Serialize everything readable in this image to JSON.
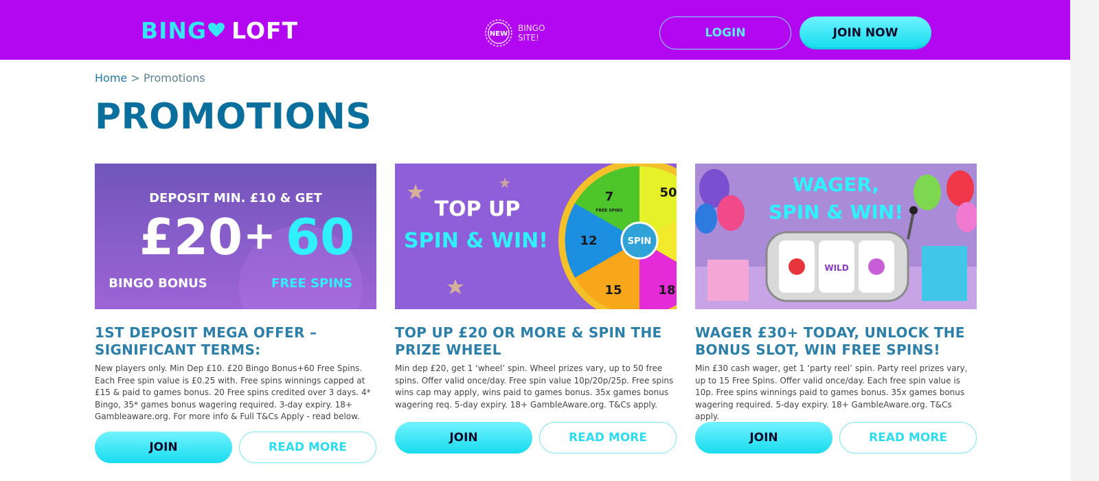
{
  "header": {
    "logo_part1": "BING",
    "logo_part2": "LOFT",
    "badge_seal": "NEW",
    "badge_line1": "BINGO",
    "badge_line2": "SITE!",
    "login_label": "LOGIN",
    "join_now_label": "JOIN NOW"
  },
  "breadcrumb": {
    "home": "Home",
    "separator": ">",
    "current": "Promotions"
  },
  "page_title": "PROMOTIONS",
  "promos": [
    {
      "banner": {
        "line1": "DEPOSIT MIN. £10 & GET",
        "amount1": "£20",
        "plus": "+",
        "amount2": "60",
        "label1": "BINGO BONUS",
        "label2": "FREE SPINS"
      },
      "title": "1ST DEPOSIT MEGA OFFER – SIGNIFICANT TERMS:",
      "terms": "New players only. Min Dep £10. £20 Bingo Bonus+60 Free Spins. Each Free spin value is £0.25 with. Free spins winnings capped at £15 & paid to games bonus. 20 Free spins credited over 3 days. 4* Bingo, 35* games bonus wagering required. 3-day expiry. 18+ Gambleaware.org. For more info & Full T&Cs Apply - read below.",
      "join_label": "JOIN",
      "read_more_label": "READ MORE"
    },
    {
      "banner": {
        "line1": "TOP UP",
        "line2": "SPIN & WIN!",
        "spin": "SPIN",
        "seg1": "7",
        "seg2": "50",
        "seg3": "12",
        "seg4": "15",
        "seg5": "18",
        "seg_word": "FREE SPINS"
      },
      "title": "TOP UP £20 OR MORE & SPIN THE PRIZE WHEEL",
      "terms": "Min dep £20, get 1 ‘wheel’ spin. Wheel prizes vary, up to 50 free spins. Offer valid once/day. Free spin value 10p/20p/25p. Free spins wins cap may apply, wins paid to games bonus. 35x games bonus wagering req. 5-day expiry. 18+ GambleAware.org. T&Cs apply.",
      "join_label": "JOIN",
      "read_more_label": "READ MORE"
    },
    {
      "banner": {
        "line1": "WAGER,",
        "line2": "SPIN & WIN!",
        "reel_wild": "WILD"
      },
      "title": "WAGER £30+ TODAY, UNLOCK THE BONUS SLOT, WIN FREE SPINS!",
      "terms": "Min £30 cash wager, get 1 ‘party reel’ spin. Party reel prizes vary, up to 15 Free Spins. Offer valid once/day. Each free spin value is 10p. Free spins winnings paid to games bonus. 35x games bonus wagering required. 5-day expiry. 18+ GambleAware.org. T&Cs apply.",
      "join_label": "JOIN",
      "read_more_label": "READ MORE"
    }
  ],
  "colors": {
    "header_bg": "#b207f0",
    "accent_cyan": "#18dcee",
    "title_blue": "#0a6f9c",
    "card_title_blue": "#2b7fa8"
  }
}
